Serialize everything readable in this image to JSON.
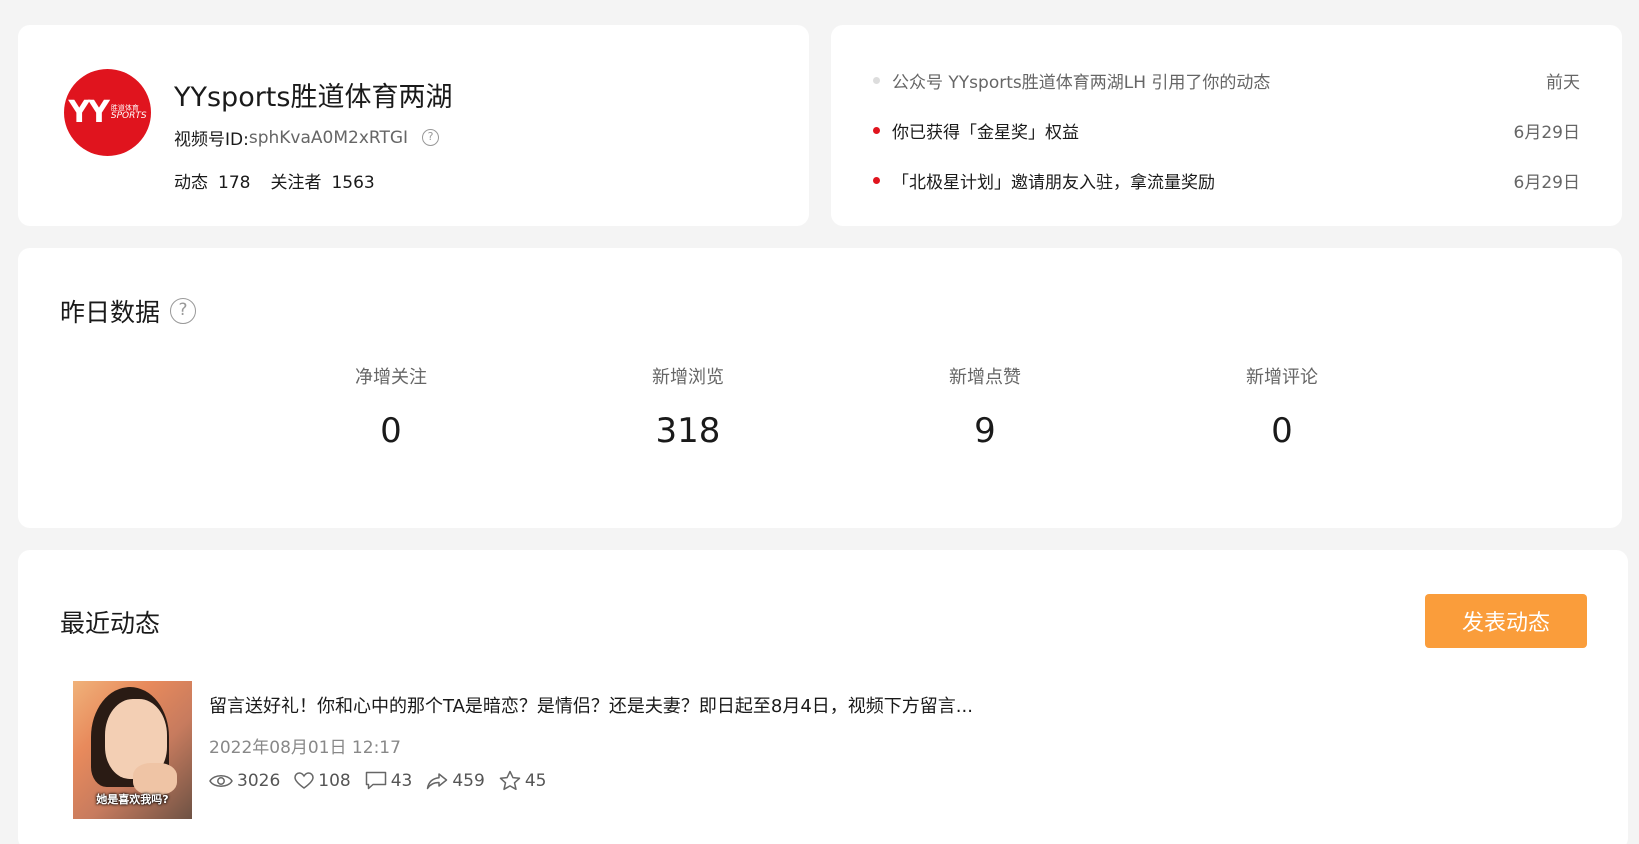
{
  "profile": {
    "avatar_text": "YY",
    "avatar_sub1": "胜道体育",
    "avatar_sub2": "SPORTS",
    "name": "YYsports胜道体育两湖",
    "id_label": "视频号ID:",
    "id_value": "sphKvaA0M2xRTGI",
    "posts_label": "动态",
    "posts_count": "178",
    "followers_label": "关注者",
    "followers_count": "1563"
  },
  "notifications": [
    {
      "text": "公众号 YYsports胜道体育两湖LH 引用了你的动态",
      "time": "前天",
      "read": true
    },
    {
      "text": "你已获得「金星奖」权益",
      "time": "6月29日",
      "read": false
    },
    {
      "text": "「北极星计划」邀请朋友入驻，拿流量奖励",
      "time": "6月29日",
      "read": false
    }
  ],
  "yesterday": {
    "title": "昨日数据",
    "metrics": [
      {
        "label": "净增关注",
        "value": "0"
      },
      {
        "label": "新增浏览",
        "value": "318"
      },
      {
        "label": "新增点赞",
        "value": "9"
      },
      {
        "label": "新增评论",
        "value": "0"
      }
    ]
  },
  "recent": {
    "title": "最近动态",
    "publish_label": "发表动态",
    "posts": [
      {
        "thumb_caption": "她是喜欢我吗?",
        "text": "留言送好礼！你和心中的那个TA是暗恋？是情侣？还是夫妻？即日起至8月4日，视频下方留言...",
        "date": "2022年08月01日 12:17",
        "views": "3026",
        "likes": "108",
        "comments": "43",
        "shares": "459",
        "favorites": "45"
      }
    ]
  },
  "colors": {
    "brand_red": "#e0141e",
    "accent_orange": "#fa9d3b",
    "background": "#f4f4f4"
  }
}
